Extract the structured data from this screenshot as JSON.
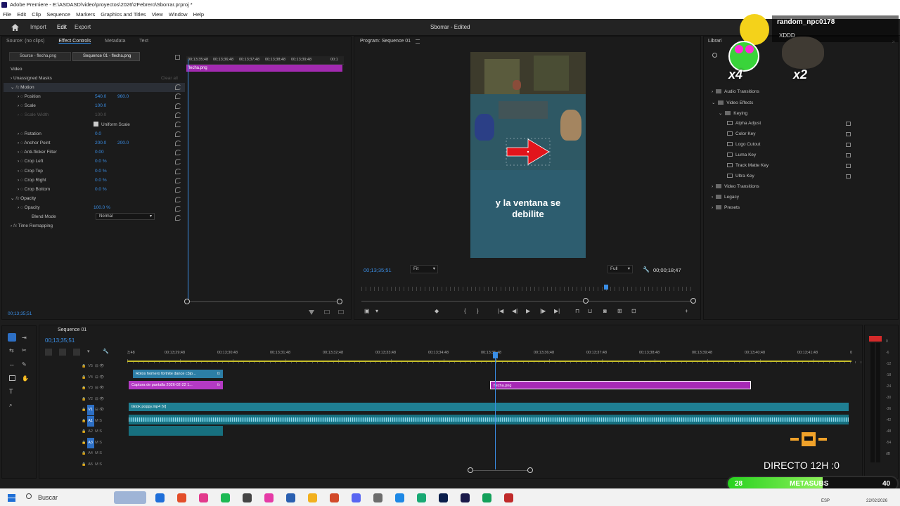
{
  "window": {
    "title": "Adobe Premiere - E:\\ASDASD\\video\\proyectos\\2026\\2Febrero\\Sborrar.prproj *",
    "menu": [
      "File",
      "Edit",
      "Clip",
      "Sequence",
      "Markers",
      "Graphics and Titles",
      "View",
      "Window",
      "Help"
    ]
  },
  "workspace": {
    "tabs": [
      "Import",
      "Edit",
      "Export"
    ],
    "active_tab": "Edit",
    "project_title": "Sborrar - Edited"
  },
  "effect_controls": {
    "tabs": [
      "Source: (no clips)",
      "Effect Controls",
      "Metadata",
      "Text"
    ],
    "subtabs": [
      "Source - flecha.png",
      "Sequence 01 - flecha.png"
    ],
    "section_video": "Video",
    "unassigned_masks": "Unassigned Masks",
    "clear_all": "Clear all",
    "clip_label": "flecha.png",
    "ruler_times": [
      "00;13;35;48",
      "00;13;36;48",
      "00;13;37;48",
      "00;13;38;48",
      "00;13;39;48",
      "00;1"
    ],
    "motion": "Motion",
    "props": [
      {
        "name": "Position",
        "v1": "540.0",
        "v2": "960.0"
      },
      {
        "name": "Scale",
        "v1": "100.0",
        "v2": ""
      },
      {
        "name": "Scale Width",
        "v1": "100.0",
        "v2": "",
        "dim": true
      },
      {
        "name": "Uniform Scale",
        "checkbox": true
      },
      {
        "name": "Rotation",
        "v1": "0.0",
        "v2": ""
      },
      {
        "name": "Anchor Point",
        "v1": "200.0",
        "v2": "200.0"
      },
      {
        "name": "Anti-flicker Filter",
        "v1": "0.00",
        "v2": ""
      },
      {
        "name": "Crop Left",
        "v1": "0.0 %",
        "v2": ""
      },
      {
        "name": "Crop Top",
        "v1": "0.0 %",
        "v2": ""
      },
      {
        "name": "Crop Right",
        "v1": "0.0 %",
        "v2": ""
      },
      {
        "name": "Crop Bottom",
        "v1": "0.0 %",
        "v2": ""
      }
    ],
    "opacity_section": "Opacity",
    "opacity_label": "Opacity",
    "opacity_value": "100.0 %",
    "blend_label": "Blend Mode",
    "blend_value": "Normal",
    "time_remap": "Time Remapping",
    "timecode": "00;13;35;51"
  },
  "program": {
    "title": "Program: Sequence 01",
    "caption_line1": "y la ventana se",
    "caption_line2": "debilite",
    "timecode": "00;13;35;51",
    "fit": "Fit",
    "quality": "Full",
    "duration": "00;00;18;47"
  },
  "libraries": {
    "tab": "Librari",
    "items": [
      {
        "label": "Audio Transitions",
        "indent": 0
      },
      {
        "label": "Video Effects",
        "indent": 0
      },
      {
        "label": "Keying",
        "indent": 1
      },
      {
        "label": "Alpha Adjust",
        "indent": 2
      },
      {
        "label": "Color Key",
        "indent": 2
      },
      {
        "label": "Logo Cutout",
        "indent": 2
      },
      {
        "label": "Luma Key",
        "indent": 2
      },
      {
        "label": "Track Matte Key",
        "indent": 2
      },
      {
        "label": "Ultra Key",
        "indent": 2
      },
      {
        "label": "Video Transitions",
        "indent": 0
      },
      {
        "label": "Legacy",
        "indent": 0
      },
      {
        "label": "Presets",
        "indent": 0
      }
    ]
  },
  "stream_overlay": {
    "username": "random_npc0178",
    "sub": "XDDD",
    "mult1": "x4",
    "mult2": "x2",
    "directo": "DIRECTO 12H :0",
    "bar_left": "28",
    "bar_label": "METASUBS",
    "bar_right": "40",
    "bar_fill": 0.55
  },
  "timeline": {
    "title": "Sequence 01",
    "timecode": "00;13;35;51",
    "ruler": [
      "3;48",
      "00;13;29;48",
      "00;13;30;48",
      "00;13;31;48",
      "00;13;32;48",
      "00;13;33;48",
      "00;13;34;48",
      "00;13;35;48",
      "00;13;36;48",
      "00;13;37;48",
      "00;13;38;48",
      "00;13;39;48",
      "00;13;40;48",
      "00;13;41;48",
      "0"
    ],
    "tracks": [
      "V5",
      "V4",
      "V3",
      "V2",
      "V1",
      "A1",
      "A2",
      "A3",
      "A4",
      "A5"
    ],
    "clips": [
      {
        "label": "Rotos homero fortnite dance c3jo...",
        "fx": "fx"
      },
      {
        "label": "Captura de pantalla 2026-02-22 1...",
        "fx": "fx"
      },
      {
        "label": "flecha.png"
      },
      {
        "label": "tiktok poppy.mp4 [V]"
      }
    ],
    "meter_labels": [
      "0",
      "-6",
      "-12",
      "-18",
      "-24",
      "-30",
      "-36",
      "-42",
      "-48",
      "-54",
      "dB"
    ]
  },
  "taskbar": {
    "search": "Buscar",
    "date": "22/02/2026",
    "lang": "ESP"
  }
}
